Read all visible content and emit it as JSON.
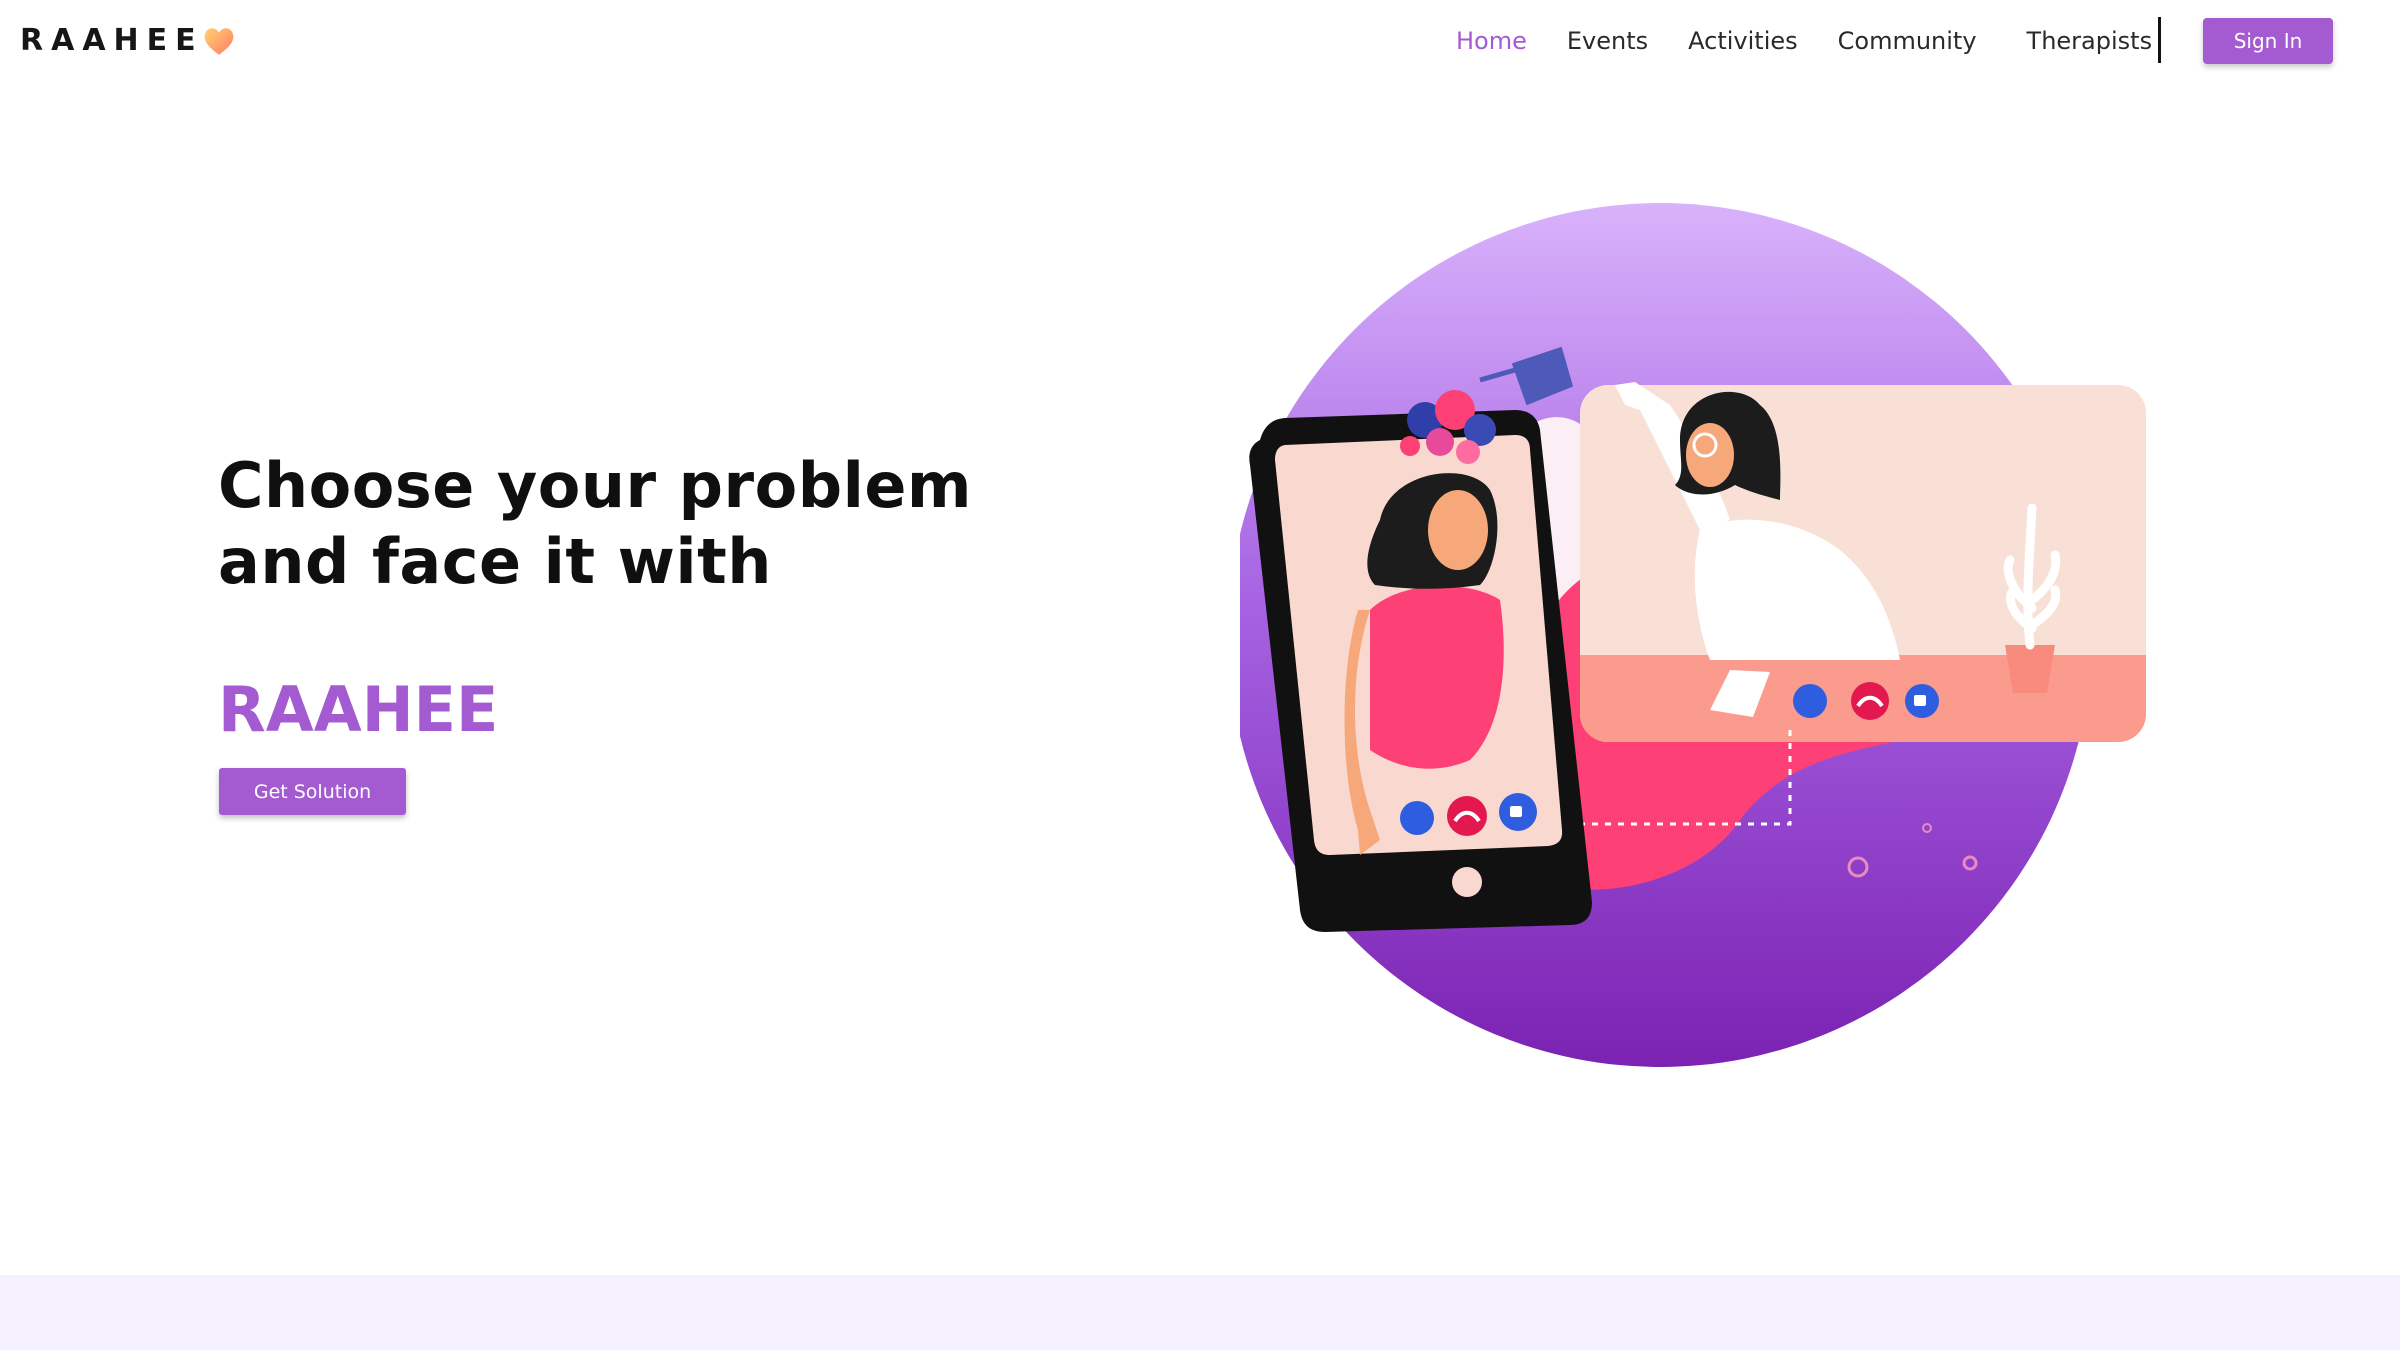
{
  "brand": {
    "name": "RAAHEE",
    "heart_icon": "heart-icon"
  },
  "nav": {
    "links": [
      {
        "label": "Home",
        "active": true
      },
      {
        "label": "Events",
        "active": false
      },
      {
        "label": "Activities",
        "active": false
      },
      {
        "label": "Community",
        "active": false
      },
      {
        "label": "Therapists",
        "active": false
      }
    ],
    "signin_label": "Sign In"
  },
  "hero": {
    "title": "Choose your problem and face it with",
    "brand": "RAAHEE",
    "cta_label": "Get Solution"
  },
  "colors": {
    "accent": "#a45bd2",
    "footer_band": "#f5f0fd",
    "circle_top": "#d8b2fb",
    "circle_bottom": "#7b22b3",
    "pink": "#fd4176",
    "call_blue": "#2f5de0",
    "call_red": "#e2184f"
  }
}
